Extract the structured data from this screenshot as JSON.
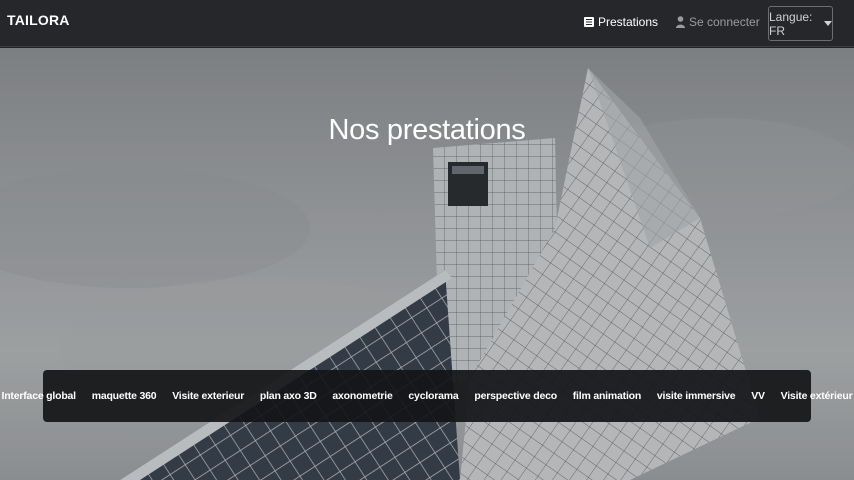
{
  "brand": "TAILORA",
  "nav": {
    "prestations_label": "Prestations",
    "login_label": "Se connecter",
    "language_label": "Langue: FR"
  },
  "hero": {
    "title": "Nos prestations"
  },
  "menu": [
    "Interface global",
    "maquette 360",
    "Visite exterieur",
    "plan axo 3D",
    "axonometrie",
    "cyclorama",
    "perspective deco",
    "film animation",
    "visite immersive",
    "VV",
    "Visite extérieur"
  ],
  "icons": {
    "prestations": "list-icon",
    "login": "user-icon",
    "language": "caret-down-icon"
  }
}
